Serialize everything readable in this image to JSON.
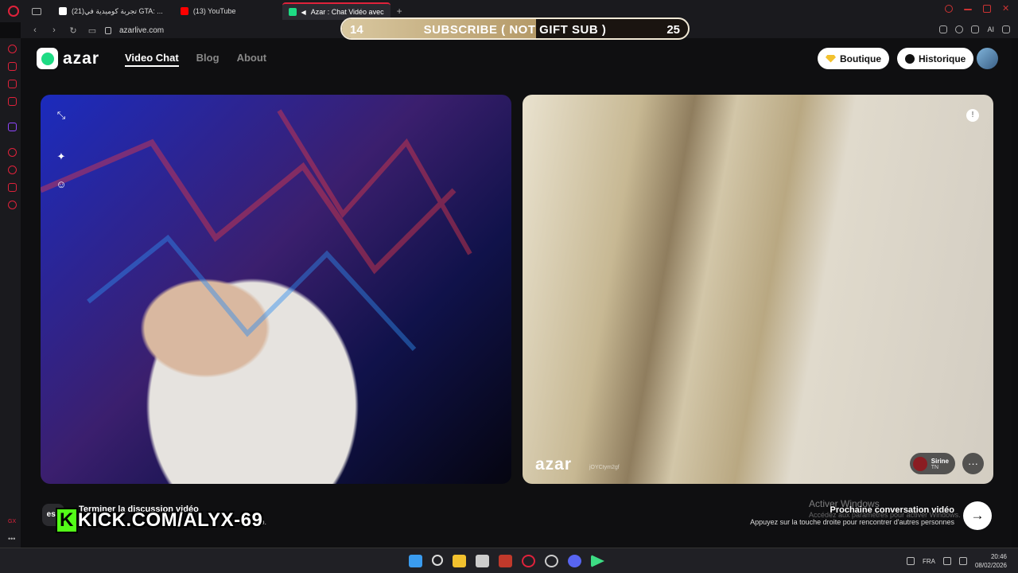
{
  "browser": {
    "tabs": [
      {
        "label": "(21)تجربة كوميدية في GTA: ...",
        "icon_color": "#ffffff",
        "active": false
      },
      {
        "label": "(13) YouTube",
        "icon_color": "#ff0000",
        "active": false
      },
      {
        "label": "Azar : Chat Vidéo avec",
        "icon_color": "#1edb84",
        "active": true
      }
    ],
    "url": "azarlive.com",
    "ai_label": "AI"
  },
  "overlay": {
    "left_count": "14",
    "text": "SUBSCRIBE ( NOT GIFT SUB )",
    "right_count": "25",
    "progress": 0.56
  },
  "site": {
    "logo": "azar",
    "nav": [
      "Video Chat",
      "Blog",
      "About"
    ],
    "boutique": "Boutique",
    "historique": "Historique"
  },
  "remote": {
    "watermark": "azar",
    "watermark_id": "jOYCtym2gf",
    "user_name": "Sirine",
    "country": "TN"
  },
  "bottom": {
    "end_key": "esc",
    "end_title": "Terminer la discussion vidéo",
    "end_sub": "at vidéo.",
    "kick_text": "KICK.COM/ALYX-69",
    "activate_title": "Activer Windows",
    "activate_sub": "Accédez aux paramètres pour activer Windows.",
    "next_title": "Prochaine conversation vidéo",
    "next_sub": "Appuyez sur la touche droite pour rencontrer d'autres personnes"
  },
  "taskbar": {
    "lang": "FRA",
    "time": "20:46",
    "date": "08/02/2026"
  }
}
